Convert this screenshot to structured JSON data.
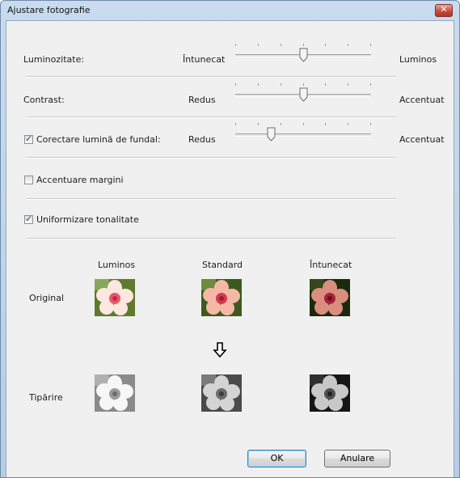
{
  "window": {
    "title": "Ajustare fotografie"
  },
  "brightness": {
    "label": "Luminozitate:",
    "min_label": "Întunecat",
    "max_label": "Luminos",
    "value": 0.5
  },
  "contrast": {
    "label": "Contrast:",
    "min_label": "Redus",
    "max_label": "Accentuat",
    "value": 0.5
  },
  "backlight": {
    "label": "Corectare lumină de fundal:",
    "checked": true,
    "min_label": "Redus",
    "max_label": "Accentuat",
    "value": 0.25
  },
  "sharpen": {
    "label": "Accentuare margini",
    "checked": false
  },
  "tone": {
    "label": "Uniformizare tonalitate",
    "checked": true
  },
  "preview": {
    "col_bright": "Luminos",
    "col_standard": "Standard",
    "col_dark": "Întunecat",
    "row_original": "Original",
    "row_print": "Tipărire",
    "arrow_icon": "arrow-down-icon"
  },
  "buttons": {
    "ok": "OK",
    "cancel": "Anulare"
  }
}
